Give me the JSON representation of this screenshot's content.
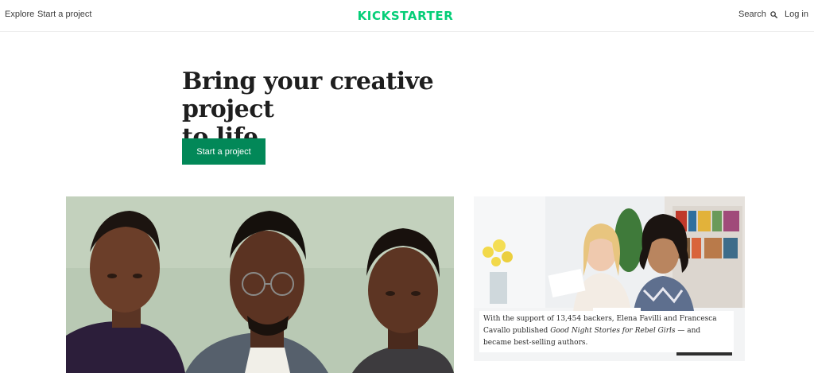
{
  "nav": {
    "explore": "Explore",
    "start_project": "Start a project",
    "brand": "KICKSTARTER",
    "search": "Search",
    "login": "Log in"
  },
  "hero": {
    "title_line1": "Bring your creative project",
    "title_line2": "to life.",
    "cta": "Start a project"
  },
  "feature": {
    "caption_part1": "With the support of 13,454 backers, Elena Favilli and Francesca Cavallo published ",
    "caption_title": "Good Night Stories for Rebel Girls",
    "caption_part2": " — and became best-selling authors."
  },
  "colors": {
    "brand_green": "#05ce78",
    "cta_green": "#028858"
  },
  "icons": {
    "search": "search-icon"
  }
}
